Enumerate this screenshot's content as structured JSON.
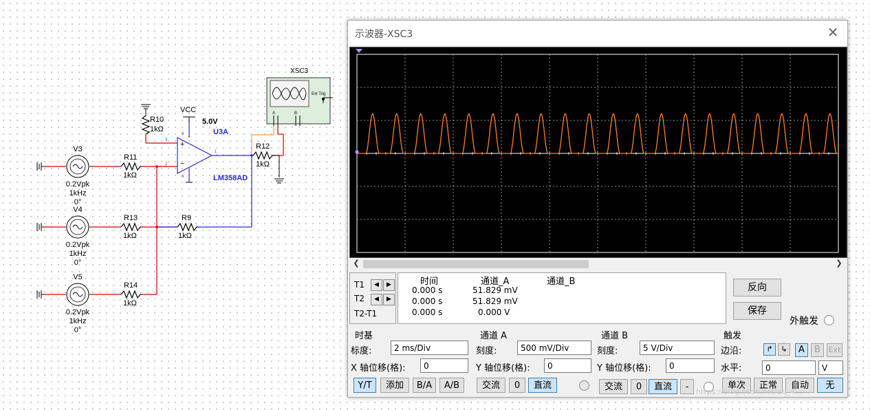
{
  "schematic": {
    "vcc_label": "VCC",
    "vcc_value": "5.0V",
    "opamp_ref": "U3A",
    "opamp_part": "LM358AD",
    "scope_ref": "XSC3",
    "scope_ext_trig": "Ext Trig",
    "scope_ch_a": "A",
    "scope_ch_b": "B",
    "r10_ref": "R10",
    "r10_val": "1kΩ",
    "r11_ref": "R11",
    "r11_val": "1kΩ",
    "r12_ref": "R12",
    "r12_val": "1kΩ",
    "r13_ref": "R13",
    "r13_val": "1kΩ",
    "r14_ref": "R14",
    "r14_val": "1kΩ",
    "r9_ref": "R9",
    "r9_val": "1kΩ",
    "sources": [
      {
        "ref": "V3",
        "amp": "0.2Vpk",
        "freq": "1kHz",
        "phase": "0°"
      },
      {
        "ref": "V4",
        "amp": "0.2Vpk",
        "freq": "1kHz",
        "phase": "0°"
      },
      {
        "ref": "V5",
        "amp": "0.2Vpk",
        "freq": "1kHz",
        "phase": "0°"
      }
    ],
    "pin_labels": [
      "8",
      "3",
      "2",
      "1",
      "4"
    ]
  },
  "scope": {
    "title": "示波器-XSC3",
    "close_glyph": "✕",
    "trace_color": "#ff7f27",
    "cursor_table": {
      "headers": [
        "时间",
        "通道_A",
        "通道_B"
      ],
      "rows": [
        {
          "label": "T1",
          "time": "0.000 s",
          "a": "51.829 mV",
          "b": ""
        },
        {
          "label": "T2",
          "time": "0.000 s",
          "a": "51.829 mV",
          "b": ""
        },
        {
          "label": "T2-T1",
          "time": "0.000 s",
          "a": "0.000 V",
          "b": ""
        }
      ]
    },
    "buttons": {
      "reverse": "反向",
      "save": "保存",
      "ext_trigger": "外触发"
    },
    "timebase": {
      "title": "时基",
      "scale_label": "标度:",
      "scale_value": "2 ms/Div",
      "xpos_label": "X 轴位移(格):",
      "xpos_value": "0",
      "modes": [
        "Y/T",
        "添加",
        "B/A",
        "A/B"
      ]
    },
    "channel_a": {
      "title": "通道 A",
      "scale_label": "刻度:",
      "scale_value": "500 mV/Div",
      "ypos_label": "Y 轴位移(格):",
      "ypos_value": "0",
      "coupling": [
        "交流",
        "0",
        "直流"
      ]
    },
    "channel_b": {
      "title": "通道 B",
      "scale_label": "刻度:",
      "scale_value": "5  V/Div",
      "ypos_label": "Y 轴位移(格):",
      "ypos_value": "0",
      "coupling": [
        "交流",
        "0",
        "直流",
        "-"
      ]
    },
    "trigger": {
      "title": "触发",
      "edge_label": "边沿:",
      "edges": [
        "A",
        "B",
        "Ext"
      ],
      "level_label": "水平:",
      "level_value": "0",
      "level_unit": "V",
      "modes": [
        "单次",
        "正常",
        "自动",
        "无"
      ]
    }
  },
  "watermark": "https://blog.csdn.net/qq_4...",
  "chart_data": {
    "type": "line",
    "series": [
      {
        "color": "#ff7f27",
        "pulses": 20,
        "peak_divs": 1.2,
        "baseline_divs": 0
      }
    ],
    "xlim_divs": [
      0,
      10
    ],
    "ylim_divs": [
      -3,
      3
    ],
    "grid": true
  }
}
